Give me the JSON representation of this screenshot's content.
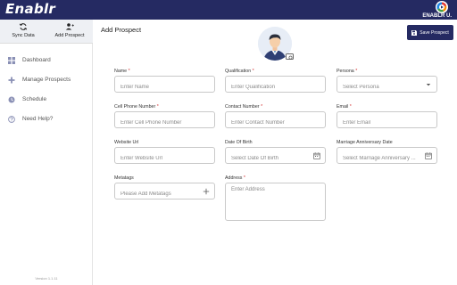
{
  "app": {
    "logo": "Enablr",
    "user_name": "ENABLR U."
  },
  "sidebar": {
    "actions": [
      {
        "label": "Sync Data",
        "icon": "sync-icon"
      },
      {
        "label": "Add Prospect",
        "icon": "add-person-icon"
      }
    ],
    "items": [
      {
        "label": "Dashboard",
        "icon": "grid-icon"
      },
      {
        "label": "Manage Prospects",
        "icon": "plus-icon"
      },
      {
        "label": "Schedule",
        "icon": "clock-icon"
      },
      {
        "label": "Need Help?",
        "icon": "help-icon"
      }
    ],
    "version": "Version 1.1.11"
  },
  "main": {
    "title": "Add Prospect",
    "save_label": "Save Prospect",
    "fields": {
      "name": {
        "label": "Name",
        "placeholder": "Enter Name",
        "required": "*"
      },
      "qualification": {
        "label": "Qualification",
        "placeholder": "Enter Qualification",
        "required": "*"
      },
      "persona": {
        "label": "Persona",
        "placeholder": "Select Persona",
        "required": "*"
      },
      "cell_phone": {
        "label": "Cell Phone Number",
        "placeholder": "Enter Cell Phone Number",
        "required": "*"
      },
      "contact_number": {
        "label": "Contact Number",
        "placeholder": "Enter Contact Number",
        "required": "*"
      },
      "email": {
        "label": "Email",
        "placeholder": "Enter Email",
        "required": "*"
      },
      "website": {
        "label": "Website Url",
        "placeholder": "Enter Website Url"
      },
      "dob": {
        "label": "Date Of Birth",
        "placeholder": "Select Date Of Birth"
      },
      "anniversary": {
        "label": "Marriage Anniversary Date",
        "placeholder": "Select Marriage Anniversary ..."
      },
      "metatags": {
        "label": "Metatags",
        "placeholder": "Please Add Metatags"
      },
      "address": {
        "label": "Address",
        "placeholder": "Enter Address",
        "required": "*"
      }
    }
  },
  "colors": {
    "brand": "#252a62",
    "required": "#d32f2f"
  }
}
